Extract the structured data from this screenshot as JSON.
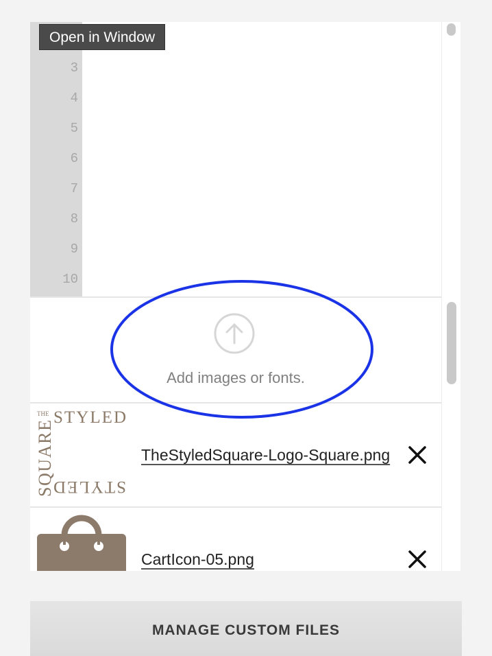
{
  "tooltip": {
    "text": "Open in Window"
  },
  "editor": {
    "line_numbers": [
      "3",
      "4",
      "5",
      "6",
      "7",
      "8",
      "9",
      "10"
    ]
  },
  "upload": {
    "label": "Add images or fonts."
  },
  "files": [
    {
      "name": "TheStyledSquare-Logo-Square.png",
      "thumbnail_text": [
        "THE",
        "STYLED",
        "SQUARE",
        "STYLED"
      ]
    },
    {
      "name": "CartIcon-05.png"
    }
  ],
  "footer": {
    "manage_label": "MANAGE CUSTOM FILES"
  },
  "colors": {
    "annotation_ellipse": "#1a33e6",
    "logo_brown": "#8c7a68",
    "cart_icon": "#8c7a6a"
  }
}
